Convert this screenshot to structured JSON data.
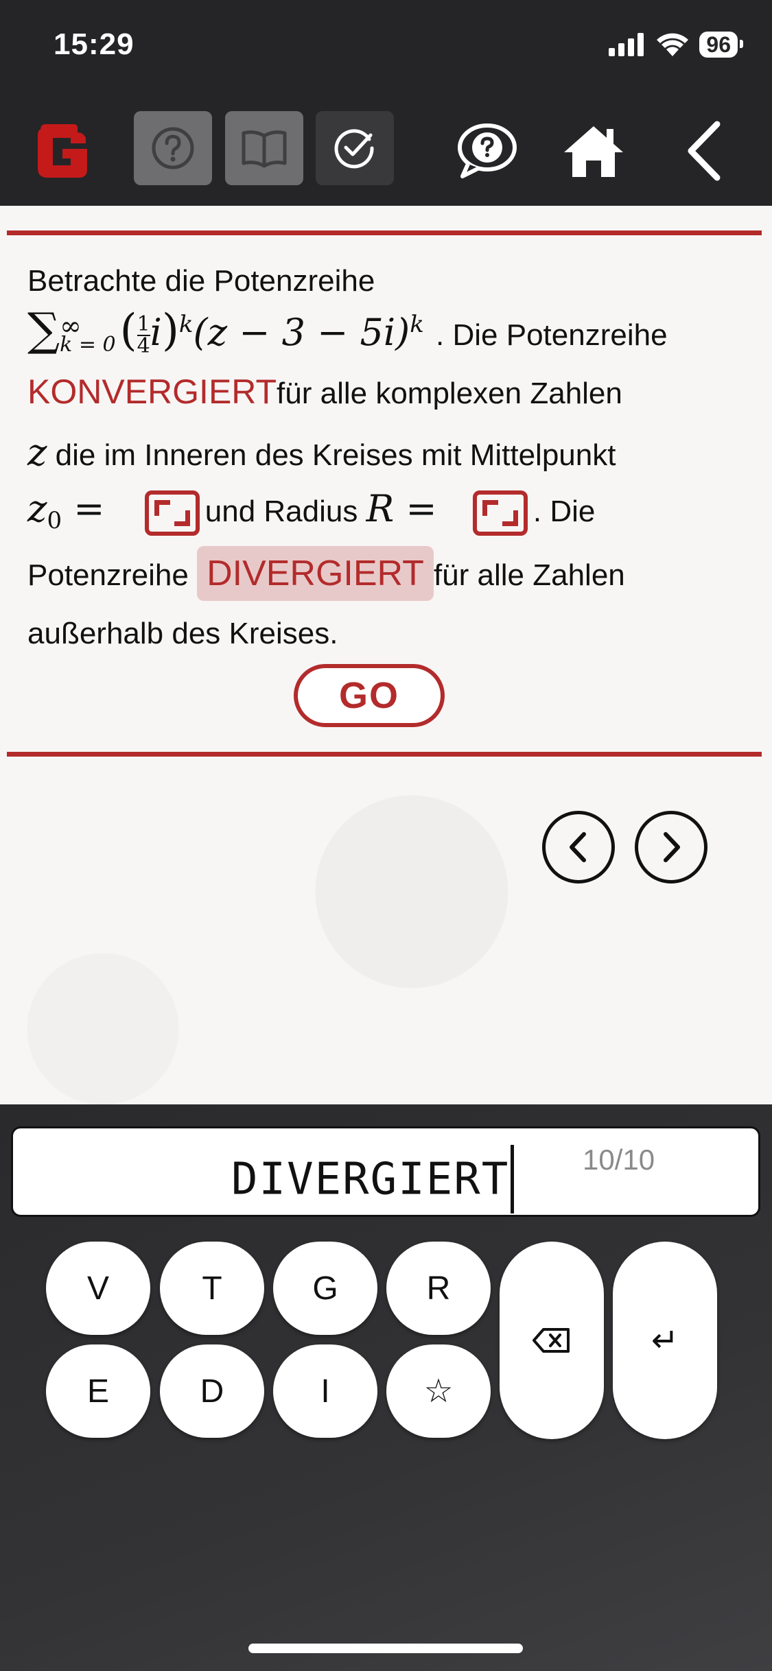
{
  "status": {
    "time": "15:29",
    "battery": "96"
  },
  "toolbar": {
    "logo_icon": "app-logo",
    "buttons": [
      "hint-question-icon",
      "book-icon",
      "check-icon",
      "chat-question-icon",
      "home-icon",
      "back-chevron-icon"
    ]
  },
  "task": {
    "intro": "Betrachte die Potenzreihe",
    "after_sum": ". Die Potenzreihe",
    "word1": "KONVERGIERT",
    "text2": "für alle komplexen Zahlen",
    "z_var": "z",
    "text3": " die im Inneren des Kreises mit Mittelpunkt",
    "z0_label": "z",
    "z0_sub": "0",
    "equals": " =",
    "text4": "und Radius",
    "R_label": "R =",
    "text5": ". Die",
    "text6": "Potenzreihe",
    "word2": "DIVERGIERT",
    "text7": "für alle Zahlen",
    "text8": "außerhalb des Kreises.",
    "formula": {
      "sum": "∑",
      "upper": "∞",
      "lower": "k = 0",
      "frac_num": "1",
      "frac_den": "4",
      "i": "i",
      "exp": "k",
      "paren_expr": "(z − 3 − 5i)"
    },
    "go_label": "GO"
  },
  "input": {
    "value": "DIVERGIERT",
    "counter": "10/10"
  },
  "keyboard": {
    "row1": [
      "V",
      "T",
      "G",
      "R"
    ],
    "row2": [
      "E",
      "D",
      "I",
      "☆"
    ],
    "backspace": "⌫",
    "enter": "↵"
  },
  "colors": {
    "accent": "#b32b2b",
    "bar": "#252527",
    "highlight": "#e8c9c9"
  }
}
